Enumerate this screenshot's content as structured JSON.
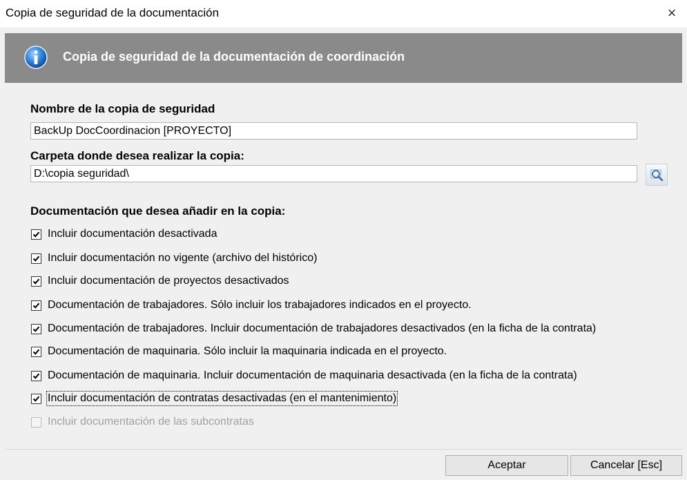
{
  "window": {
    "title": "Copia de seguridad de la documentación",
    "close_glyph": "×"
  },
  "header": {
    "icon": "info-icon",
    "title": "Copia de seguridad de la documentación de coordinación"
  },
  "form": {
    "name_label": "Nombre de la copia de seguridad",
    "name_value": "BackUp DocCoordinacion [PROYECTO]",
    "folder_label": "Carpeta donde desea realizar la copia:",
    "folder_value": "D:\\copia seguridad\\",
    "browse_icon": "magnifier-icon",
    "docs_label": "Documentación que desea añadir en la copia:"
  },
  "options": [
    {
      "label": "Incluir documentación desactivada",
      "checked": true,
      "enabled": true
    },
    {
      "label": "Incluir documentación no vigente (archivo del histórico)",
      "checked": true,
      "enabled": true
    },
    {
      "label": "Incluir documentación de proyectos desactivados",
      "checked": true,
      "enabled": true
    },
    {
      "label": "Documentación de trabajadores. Sólo incluir los trabajadores indicados en el proyecto.",
      "checked": true,
      "enabled": true
    },
    {
      "label": "Documentación de trabajadores. Incluir documentación de trabajadores desactivados (en la ficha de la contrata)",
      "checked": true,
      "enabled": true
    },
    {
      "label": "Documentación de maquinaria. Sólo incluir la maquinaria indicada en el proyecto.",
      "checked": true,
      "enabled": true
    },
    {
      "label": "Documentación de maquinaria. Incluir documentación de maquinaria desactivada (en la ficha de la contrata)",
      "checked": true,
      "enabled": true
    },
    {
      "label": "Incluir documentación de contratas desactivadas (en el mantenimiento)",
      "checked": true,
      "enabled": true
    },
    {
      "label": "Incluir documentación de las subcontratas",
      "checked": false,
      "enabled": false
    }
  ],
  "buttons": {
    "ok_label": "Aceptar",
    "cancel_label": "Cancelar [Esc]"
  },
  "colors": {
    "header_bg": "#8a8a8a",
    "window_bg": "#f0f0f0"
  }
}
